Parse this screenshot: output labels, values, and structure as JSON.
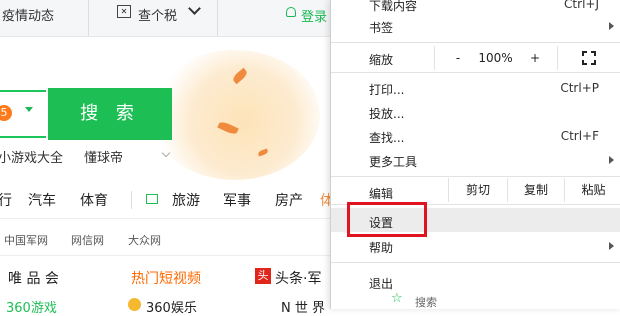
{
  "topbar": {
    "covid": "疫情动态",
    "tax": "查个税",
    "login": "登录"
  },
  "search": {
    "badge": "5",
    "button": "搜 索",
    "hot_links": [
      "小游戏大全",
      "懂球帝"
    ]
  },
  "nav": [
    "行",
    "汽车",
    "体育",
    "旅游",
    "军事",
    "房产",
    "体"
  ],
  "sub_nav": [
    "中国军网",
    "网信网",
    "大众网"
  ],
  "row3": [
    "唯 品 会",
    "热门短视频",
    "头条·军"
  ],
  "row4": [
    "360游戏",
    "360娱乐",
    "N 世 界"
  ],
  "menu": {
    "download": {
      "label": "下载内容",
      "shortcut": "Ctrl+J"
    },
    "bookmarks": "书签",
    "zoom": {
      "label": "缩放",
      "minus": "-",
      "value": "100%",
      "plus": "+"
    },
    "print": {
      "label": "打印...",
      "shortcut": "Ctrl+P"
    },
    "cast": "投放...",
    "find": {
      "label": "查找...",
      "shortcut": "Ctrl+F"
    },
    "more_tools": "更多工具",
    "edit": {
      "label": "编辑",
      "cut": "剪切",
      "copy": "复制",
      "paste": "粘贴"
    },
    "settings": "设置",
    "help": "帮助",
    "exit": "退出",
    "bottom_partial": "搜索"
  },
  "colors": {
    "accent_green": "#1dbf55",
    "highlight_red": "#e0141e",
    "orange": "#ff7a1a"
  }
}
